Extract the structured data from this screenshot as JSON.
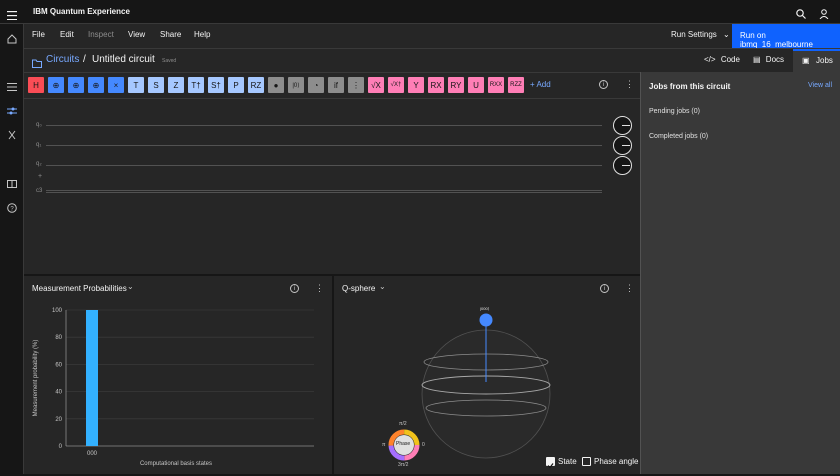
{
  "app": {
    "title": "IBM Quantum Experience"
  },
  "menu": [
    "File",
    "Edit",
    "Inspect",
    "View",
    "Share",
    "Help"
  ],
  "run": {
    "settings_label": "Run Settings",
    "run_button_label": "Run on ibmq_16_melbourne"
  },
  "breadcrumb": {
    "root": "Circuits",
    "separator": "/",
    "title": "Untitled circuit",
    "status": "Saved"
  },
  "tabs": [
    "Code",
    "Docs",
    "Jobs"
  ],
  "gates": [
    {
      "label": "H",
      "color": "red"
    },
    {
      "label": "⊕",
      "color": "blue"
    },
    {
      "label": "⊕",
      "color": "blue"
    },
    {
      "label": "⊕",
      "color": "blue"
    },
    {
      "label": "×",
      "color": "blue"
    },
    {
      "label": "T",
      "color": "light"
    },
    {
      "label": "S",
      "color": "light"
    },
    {
      "label": "Z",
      "color": "light"
    },
    {
      "label": "T†",
      "color": "light"
    },
    {
      "label": "S†",
      "color": "light"
    },
    {
      "label": "P",
      "color": "light"
    },
    {
      "label": "RZ",
      "color": "light"
    },
    {
      "label": "●",
      "color": "gray"
    },
    {
      "label": "|0⟩",
      "color": "gray"
    },
    {
      "label": "◔",
      "color": "gray"
    },
    {
      "label": "if",
      "color": "gray"
    },
    {
      "label": "⋮",
      "color": "gray"
    },
    {
      "label": "√X",
      "color": "pink"
    },
    {
      "label": "√X†",
      "color": "pink"
    },
    {
      "label": "Y",
      "color": "pink"
    },
    {
      "label": "RX",
      "color": "pink"
    },
    {
      "label": "RY",
      "color": "pink"
    },
    {
      "label": "U",
      "color": "pink"
    },
    {
      "label": "RXX",
      "color": "pink"
    },
    {
      "label": "RZZ",
      "color": "pink"
    }
  ],
  "add_label": "+ Add",
  "qubits": [
    "q₀",
    "q₁",
    "q₂",
    "c3"
  ],
  "classical_plus": "+",
  "jobs": {
    "title": "Jobs from this circuit",
    "view_all": "View all",
    "pending": "Pending jobs (0)",
    "completed": "Completed jobs (0)"
  },
  "probs": {
    "title": "Measurement Probabilities",
    "ylabel": "Measurement probability (%)",
    "xlabel": "Computational basis states"
  },
  "chart_data": {
    "type": "bar",
    "categories": [
      "000"
    ],
    "values": [
      100
    ],
    "ylabel": "Measurement probability (%)",
    "xlabel": "Computational basis states",
    "ylim": [
      0,
      100
    ],
    "yticks": [
      0,
      20,
      40,
      60,
      80,
      100
    ],
    "bar_color": "#33b1ff",
    "grid": true
  },
  "qsphere": {
    "title": "Q-sphere",
    "state_label": "|000⟩",
    "phase_label": "Phase",
    "phase_top": "π/2",
    "phase_bottom": "3π/2",
    "phase_left": "π",
    "phase_right": "0",
    "checkbox_state": "State",
    "checkbox_phase": "Phase angle",
    "state_checked": true,
    "phase_checked": false
  },
  "colors": {
    "accent": "#0f62fe",
    "red": "#fa4d56",
    "blue": "#4589ff",
    "light": "#a6c8ff",
    "gray": "#8d8d8d",
    "pink": "#ff7eb6"
  }
}
